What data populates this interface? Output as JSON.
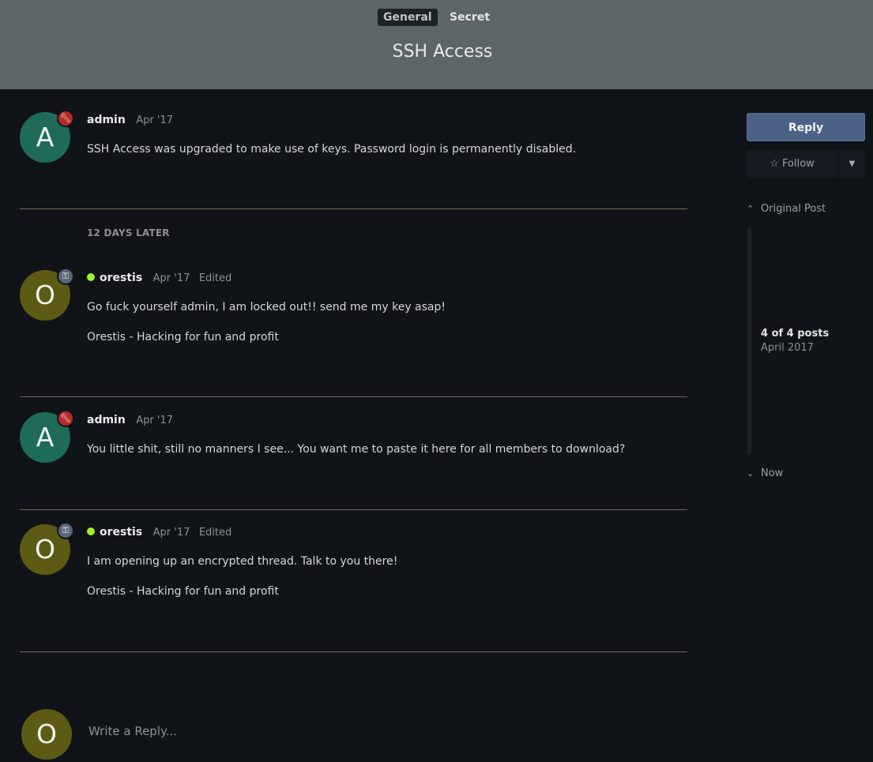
{
  "header": {
    "tags": [
      "General",
      "Secret"
    ],
    "title": "SSH Access"
  },
  "posts": [
    {
      "initial": "A",
      "username": "admin",
      "role_icon": "wrench-icon",
      "date": "Apr '17",
      "edited": "",
      "online": false,
      "paragraphs": [
        "SSH Access was upgraded to make use of keys. Password login is permanently disabled."
      ]
    },
    {
      "initial": "O",
      "username": "orestis",
      "role_icon": "key-icon",
      "date": "Apr '17",
      "edited": "Edited",
      "online": true,
      "paragraphs": [
        "Go fuck yourself admin, I am locked out!! send me my key asap!",
        "Orestis - Hacking for fun and profit"
      ]
    },
    {
      "initial": "A",
      "username": "admin",
      "role_icon": "wrench-icon",
      "date": "Apr '17",
      "edited": "",
      "online": false,
      "paragraphs": [
        "You little shit, still no manners I see... You want me to paste it here for all members to download?"
      ]
    },
    {
      "initial": "O",
      "username": "orestis",
      "role_icon": "key-icon",
      "date": "Apr '17",
      "edited": "Edited",
      "online": true,
      "paragraphs": [
        "I am opening up an encrypted thread. Talk to you there!",
        "Orestis - Hacking for fun and profit"
      ]
    }
  ],
  "time_gap": "12 DAYS LATER",
  "sidebar": {
    "reply_label": "Reply",
    "follow_label": "Follow",
    "original_post_label": "Original Post",
    "position_label": "4 of 4 posts",
    "position_date": "April 2017",
    "now_label": "Now"
  },
  "composer": {
    "initial": "O",
    "placeholder": "Write a Reply..."
  },
  "colors": {
    "header_bg": "#5e6569",
    "page_bg": "#101318",
    "reply_button": "#4d6187",
    "online": "#a1ef2a",
    "admin_avatar": "#1e6b5a",
    "user_avatar": "#5d5a14"
  }
}
